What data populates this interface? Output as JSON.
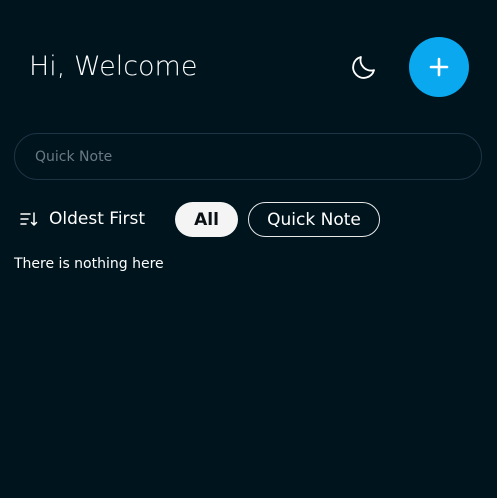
{
  "header": {
    "greeting": "Hi, Welcome",
    "theme_icon": "moon-icon",
    "add_icon": "plus-icon"
  },
  "quick_note": {
    "placeholder": "Quick Note",
    "value": ""
  },
  "filters": {
    "sort_icon": "sort-icon",
    "sort_label": "Oldest First",
    "chips": [
      {
        "label": "All",
        "selected": true
      },
      {
        "label": "Quick Note",
        "selected": false
      }
    ]
  },
  "notes": {
    "empty_message": "There is nothing here"
  },
  "colors": {
    "background": "#00141d",
    "accent": "#0aa9ef",
    "input_border": "#1d3444",
    "chip_selected_bg": "#f4f4f4"
  }
}
